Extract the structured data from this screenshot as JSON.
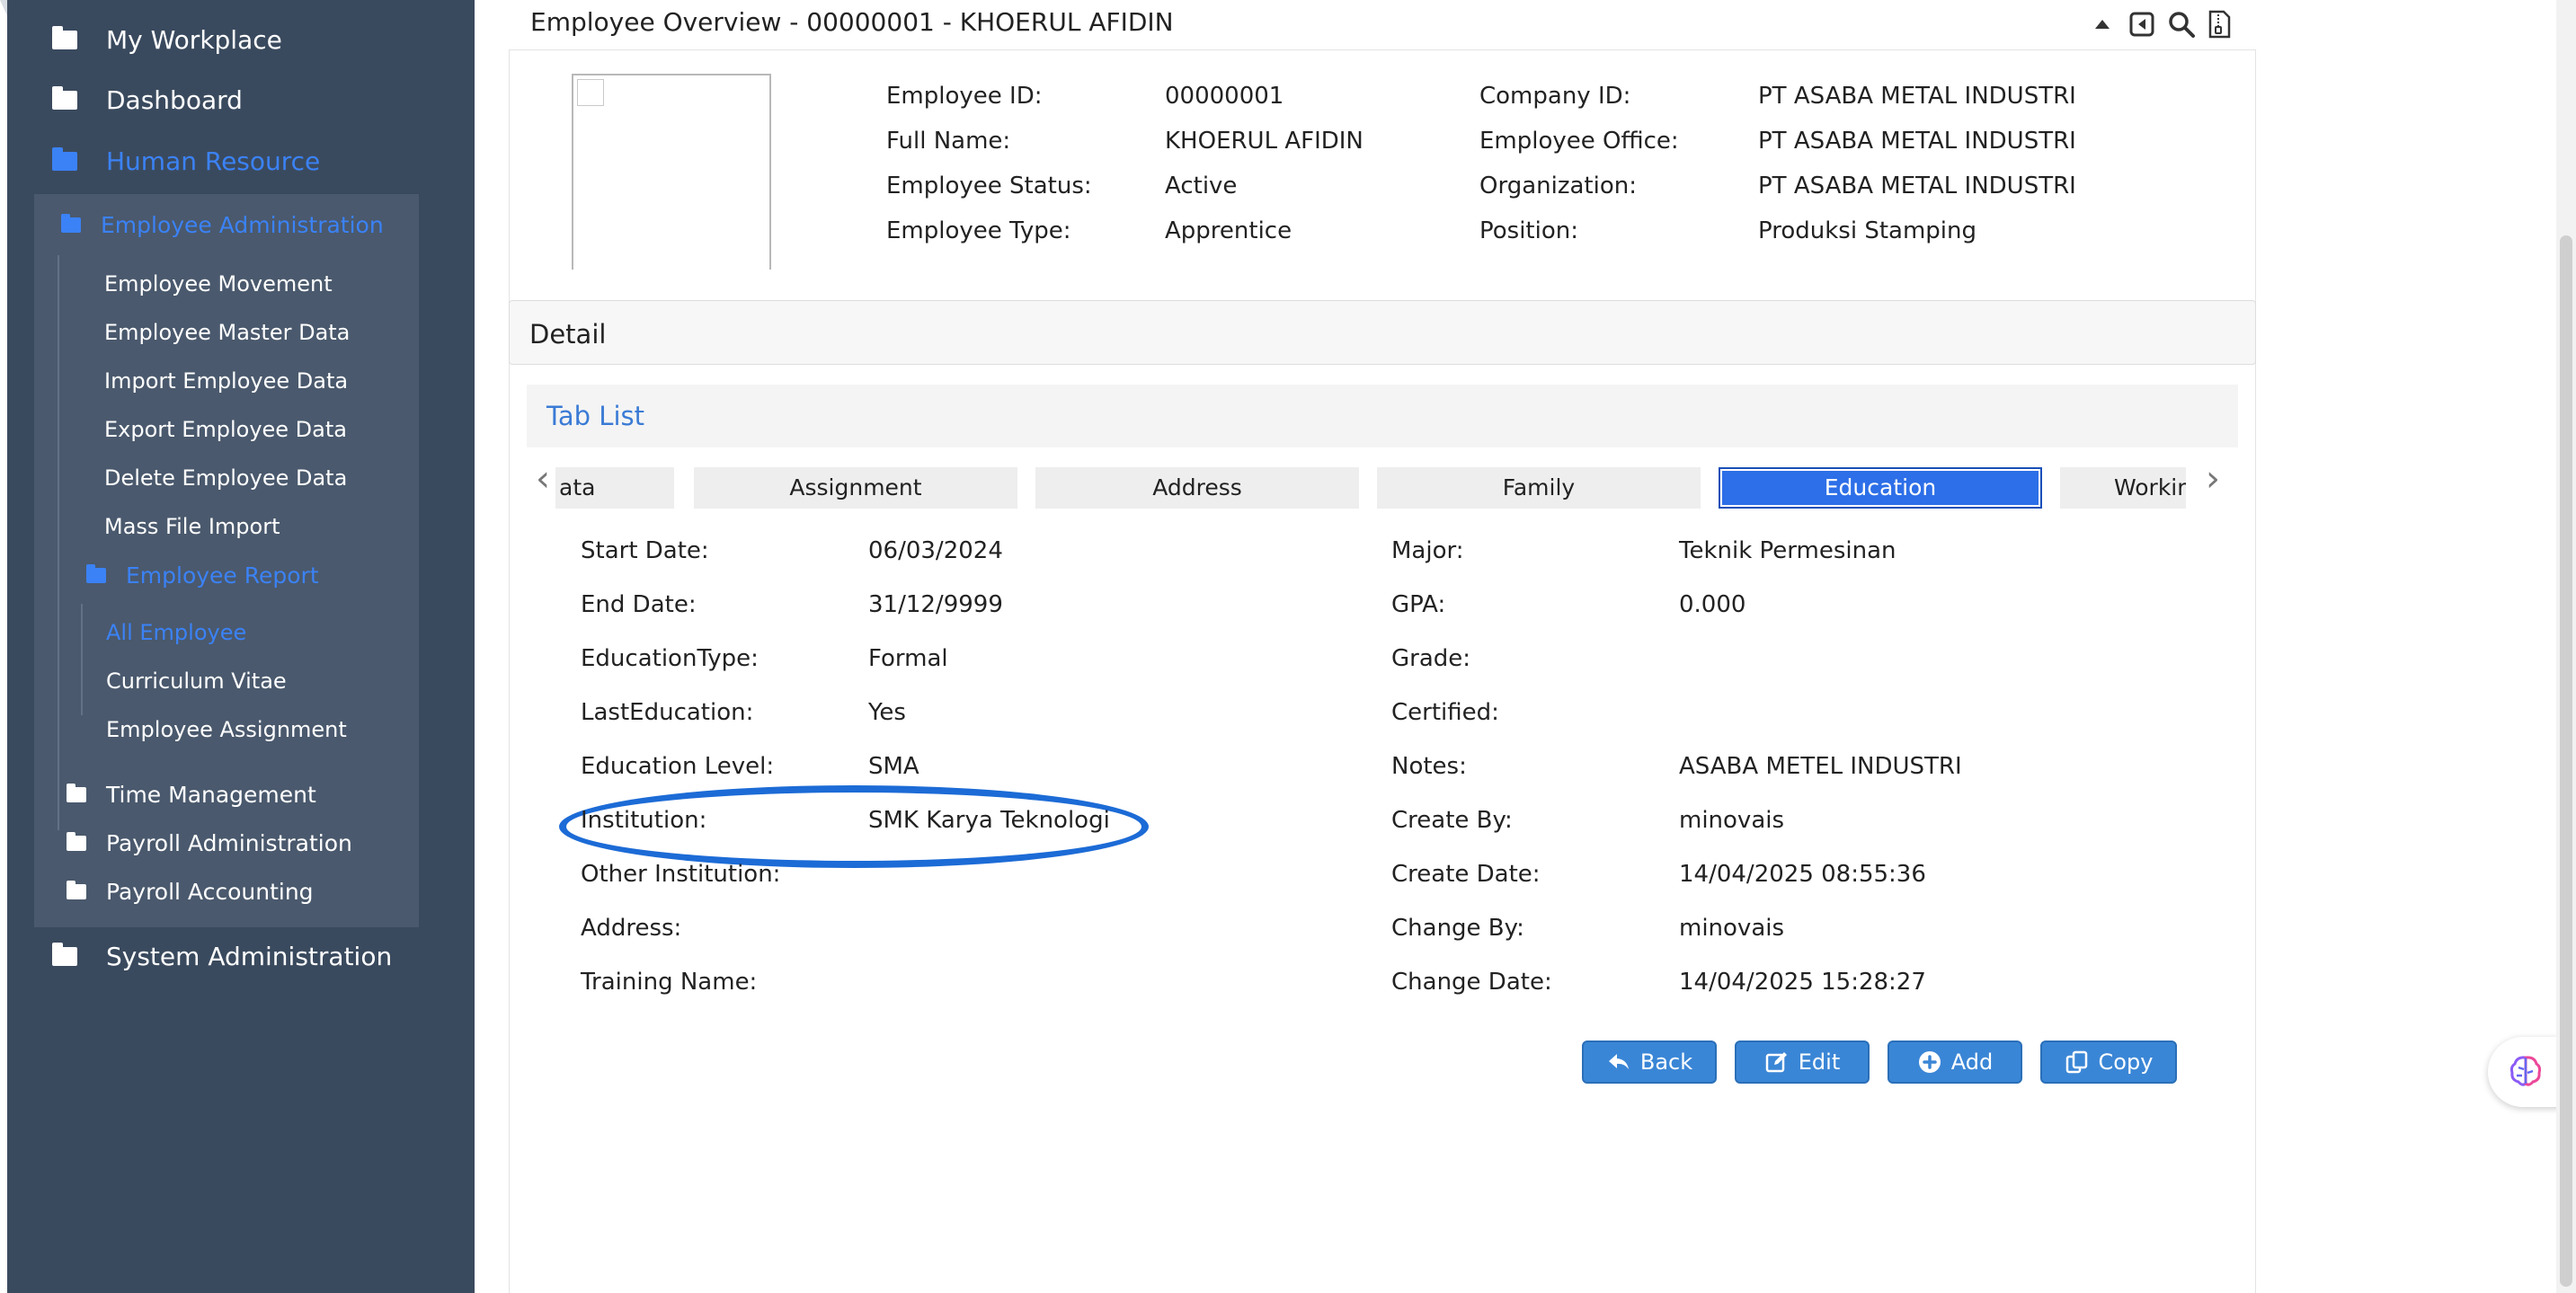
{
  "sidebar": {
    "my_workplace": "My Workplace",
    "dashboard": "Dashboard",
    "human_resource": "Human Resource",
    "employee_administration": "Employee Administration",
    "items": [
      "Employee Movement",
      "Employee Master Data",
      "Import Employee Data",
      "Export Employee Data",
      "Delete Employee Data",
      "Mass File Import"
    ],
    "employee_report": "Employee Report",
    "report_items": [
      "All Employee",
      "Curriculum Vitae",
      "Employee Assignment"
    ],
    "time_management": "Time Management",
    "payroll_administration": "Payroll Administration",
    "payroll_accounting": "Payroll Accounting",
    "system_administration": "System Administration"
  },
  "overview": {
    "title": "Employee Overview - 00000001 - KHOERUL AFIDIN",
    "fields": {
      "employee_id_label": "Employee ID:",
      "employee_id": "00000001",
      "full_name_label": "Full Name:",
      "full_name": "KHOERUL AFIDIN",
      "employee_status_label": "Employee Status:",
      "employee_status": "Active",
      "employee_type_label": "Employee Type:",
      "employee_type": "Apprentice",
      "company_id_label": "Company ID:",
      "company_id": "PT ASABA METAL INDUSTRI",
      "employee_office_label": "Employee Office:",
      "employee_office": "PT ASABA METAL INDUSTRI",
      "organization_label": "Organization:",
      "organization": "PT ASABA METAL INDUSTRI",
      "position_label": "Position:",
      "position": "Produksi Stamping"
    }
  },
  "detail": {
    "title": "Detail",
    "tab_list_title": "Tab List",
    "tabs": [
      "ata",
      "Assignment",
      "Address",
      "Family",
      "Education",
      "Workin"
    ],
    "active_tab": "Education",
    "left_fields": [
      {
        "label": "Start Date:",
        "value": "06/03/2024"
      },
      {
        "label": "End Date:",
        "value": "31/12/9999"
      },
      {
        "label": "EducationType:",
        "value": "Formal"
      },
      {
        "label": "LastEducation:",
        "value": "Yes"
      },
      {
        "label": "Education Level:",
        "value": "SMA"
      },
      {
        "label": "Institution:",
        "value": "SMK Karya Teknologi"
      },
      {
        "label": "Other Institution:",
        "value": ""
      },
      {
        "label": "Address:",
        "value": ""
      },
      {
        "label": "Training Name:",
        "value": ""
      }
    ],
    "right_fields": [
      {
        "label": "Major:",
        "value": "Teknik Permesinan"
      },
      {
        "label": "GPA:",
        "value": "0.000"
      },
      {
        "label": "Grade:",
        "value": ""
      },
      {
        "label": "Certified:",
        "value": ""
      },
      {
        "label": "Notes:",
        "value": "ASABA METEL INDUSTRI"
      },
      {
        "label": "Create By:",
        "value": "minovais"
      },
      {
        "label": "Create Date:",
        "value": "14/04/2025 08:55:36"
      },
      {
        "label": "Change By:",
        "value": "minovais"
      },
      {
        "label": "Change Date:",
        "value": "14/04/2025 15:28:27"
      }
    ]
  },
  "buttons": {
    "back": "Back",
    "edit": "Edit",
    "add": "Add",
    "copy": "Copy"
  },
  "colors": {
    "sidebar_bg": "#3a4a5e",
    "accent_blue": "#3b82f6",
    "button_blue": "#3a86d6",
    "highlight_stroke": "#1c6bd6"
  }
}
